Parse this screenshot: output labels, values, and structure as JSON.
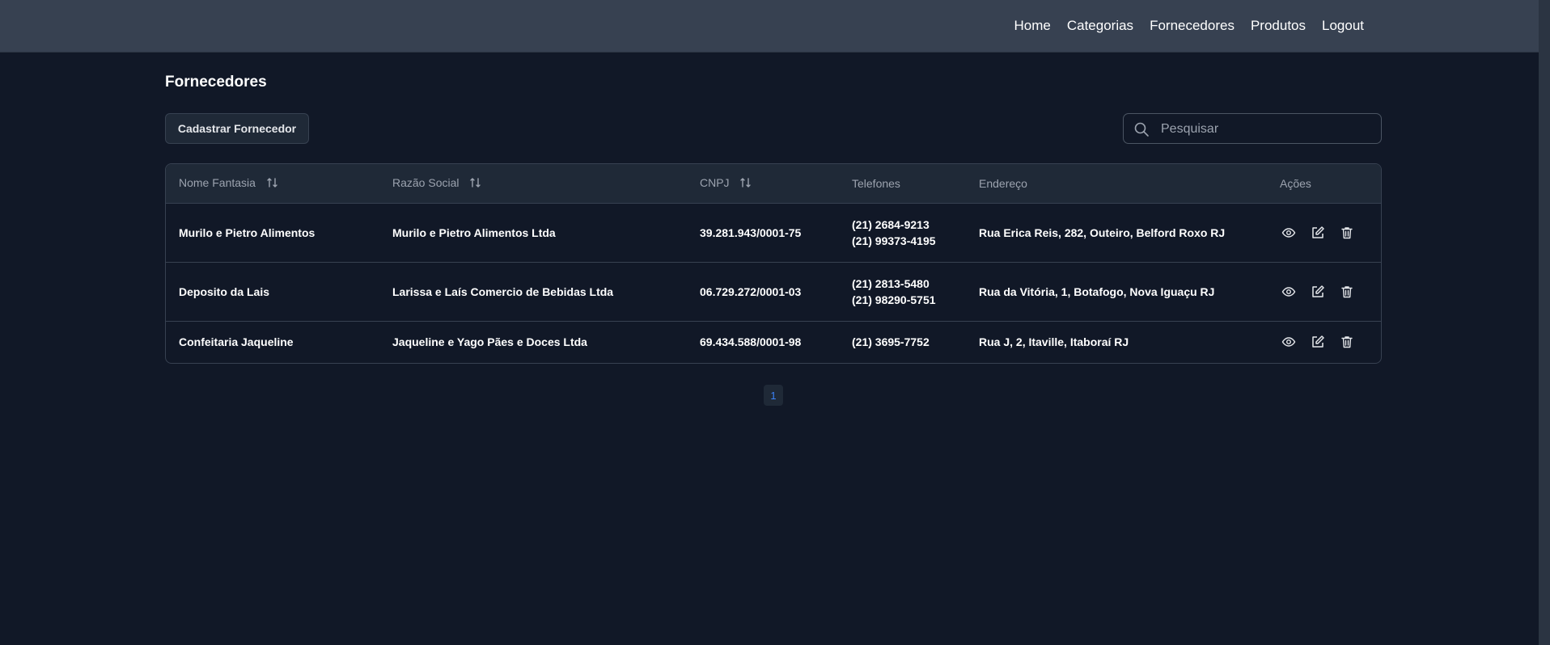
{
  "nav": {
    "links": [
      "Home",
      "Categorias",
      "Fornecedores",
      "Produtos",
      "Logout"
    ]
  },
  "page": {
    "title": "Fornecedores",
    "add_button": "Cadastrar Fornecedor"
  },
  "search": {
    "placeholder": "Pesquisar",
    "value": ""
  },
  "table": {
    "headers": {
      "nome_fantasia": "Nome Fantasia",
      "razao_social": "Razão Social",
      "cnpj": "CNPJ",
      "telefones": "Telefones",
      "endereco": "Endereço",
      "acoes": "Ações"
    },
    "rows": [
      {
        "nome_fantasia": "Murilo e Pietro Alimentos",
        "razao_social": "Murilo e Pietro Alimentos Ltda",
        "cnpj": "39.281.943/0001-75",
        "telefones": [
          "(21) 2684-9213",
          "(21) 99373-4195"
        ],
        "endereco": "Rua Erica Reis, 282, Outeiro, Belford Roxo RJ"
      },
      {
        "nome_fantasia": "Deposito da Lais",
        "razao_social": "Larissa e Laís Comercio de Bebidas Ltda",
        "cnpj": "06.729.272/0001-03",
        "telefones": [
          "(21) 2813-5480",
          "(21) 98290-5751"
        ],
        "endereco": "Rua da Vitória, 1, Botafogo, Nova Iguaçu RJ"
      },
      {
        "nome_fantasia": "Confeitaria Jaqueline",
        "razao_social": "Jaqueline e Yago Pães e Doces Ltda",
        "cnpj": "69.434.588/0001-98",
        "telefones": [
          "(21) 3695-7752"
        ],
        "endereco": "Rua J, 2, Itaville, Itaboraí RJ"
      }
    ]
  },
  "pagination": {
    "current_page": "1"
  },
  "colors": {
    "background": "#111827",
    "navbar": "#374151",
    "accent": "#3b82f6"
  }
}
